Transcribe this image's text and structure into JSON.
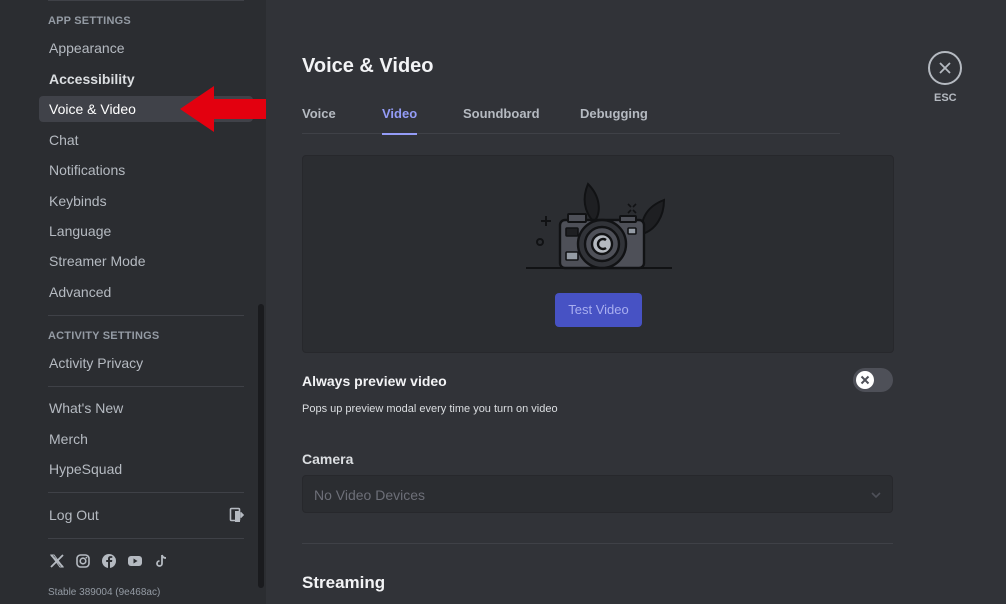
{
  "sidebar": {
    "app_settings_header": "APP SETTINGS",
    "app_items": [
      {
        "label": "Appearance"
      },
      {
        "label": "Accessibility"
      },
      {
        "label": "Voice & Video"
      },
      {
        "label": "Chat"
      },
      {
        "label": "Notifications"
      },
      {
        "label": "Keybinds"
      },
      {
        "label": "Language"
      },
      {
        "label": "Streamer Mode"
      },
      {
        "label": "Advanced"
      }
    ],
    "activity_settings_header": "ACTIVITY SETTINGS",
    "activity_items": [
      {
        "label": "Activity Privacy"
      }
    ],
    "misc_items": [
      {
        "label": "What's New"
      },
      {
        "label": "Merch"
      },
      {
        "label": "HypeSquad"
      }
    ],
    "logout_label": "Log Out",
    "socials": [
      "x-icon",
      "instagram-icon",
      "facebook-icon",
      "youtube-icon",
      "tiktok-icon"
    ],
    "version": "Stable 389004 (9e468ac)",
    "active_item": "Voice & Video"
  },
  "main": {
    "title": "Voice & Video",
    "tabs": [
      {
        "label": "Voice",
        "active": false
      },
      {
        "label": "Video",
        "active": true
      },
      {
        "label": "Soundboard",
        "active": false
      },
      {
        "label": "Debugging",
        "active": false
      }
    ],
    "preview": {
      "test_button_label": "Test Video"
    },
    "always_preview": {
      "title": "Always preview video",
      "description": "Pops up preview modal every time you turn on video",
      "enabled": false
    },
    "camera": {
      "label": "Camera",
      "value": "No Video Devices"
    },
    "streaming_title": "Streaming"
  },
  "close": {
    "label": "ESC"
  },
  "colors": {
    "accent": "#949cf7",
    "button": "#4752c4",
    "annotation_arrow": "#e3000f"
  }
}
